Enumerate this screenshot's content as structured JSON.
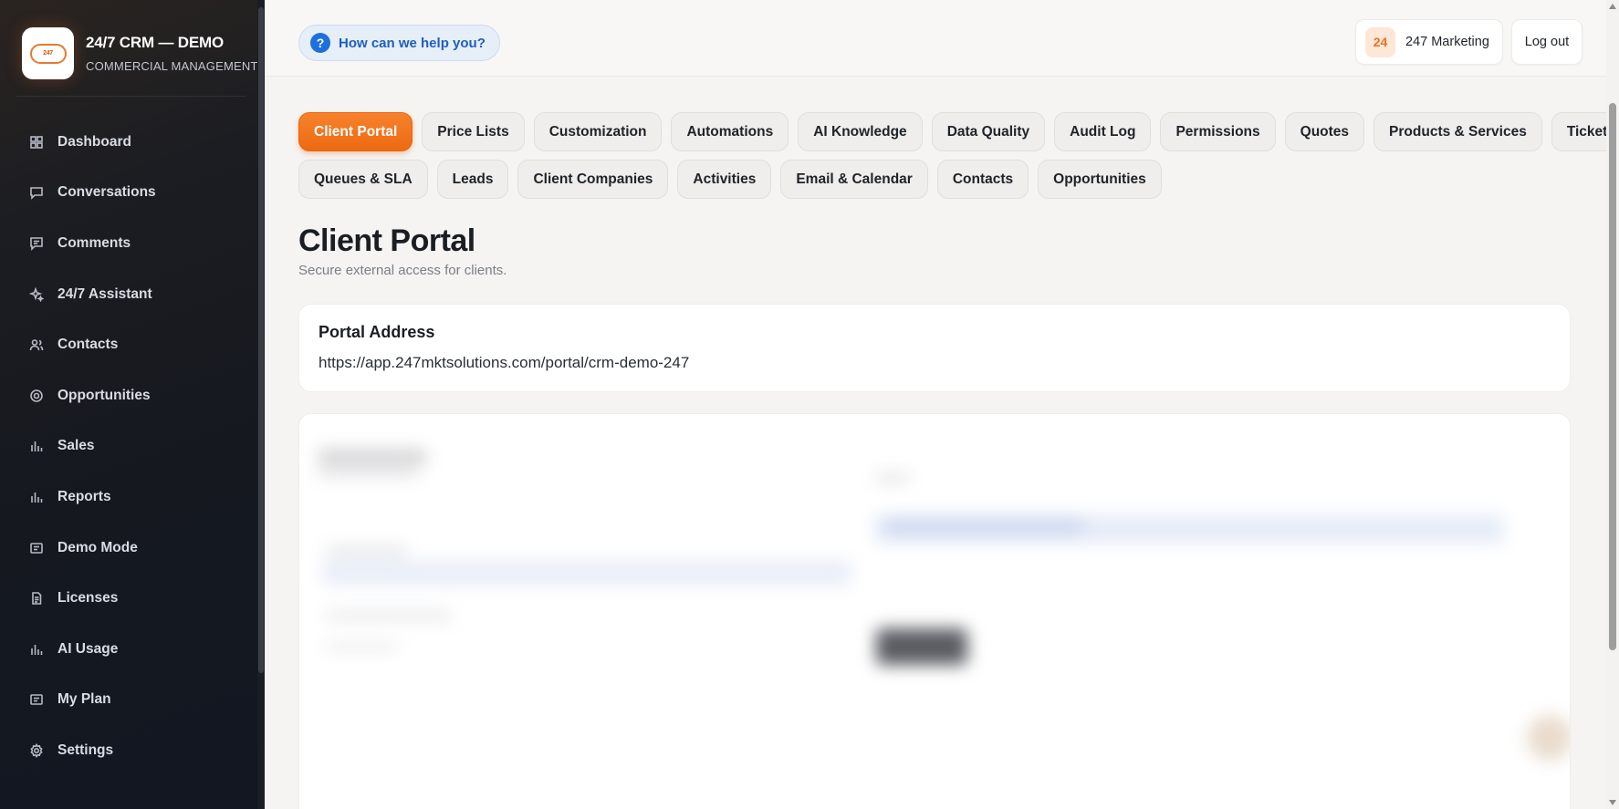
{
  "brand": {
    "title": "24/7 CRM — DEMO",
    "subtitle": "COMMERCIAL MANAGEMENT",
    "logo_text": "247"
  },
  "sidebar": {
    "items": [
      {
        "label": "Dashboard",
        "icon": "grid-icon"
      },
      {
        "label": "Conversations",
        "icon": "chat-bubble-icon"
      },
      {
        "label": "Comments",
        "icon": "comment-icon"
      },
      {
        "label": "24/7 Assistant",
        "icon": "sparkle-icon"
      },
      {
        "label": "Contacts",
        "icon": "users-icon"
      },
      {
        "label": "Opportunities",
        "icon": "target-icon"
      },
      {
        "label": "Sales",
        "icon": "bar-chart-icon"
      },
      {
        "label": "Reports",
        "icon": "bar-chart-icon"
      },
      {
        "label": "Demo Mode",
        "icon": "card-icon"
      },
      {
        "label": "Licenses",
        "icon": "document-icon"
      },
      {
        "label": "AI Usage",
        "icon": "bar-chart-icon"
      },
      {
        "label": "My Plan",
        "icon": "card-icon"
      },
      {
        "label": "Settings",
        "icon": "gear-icon"
      }
    ]
  },
  "topbar": {
    "help_label": "How can we help you?",
    "help_icon": "?",
    "account_badge": "24",
    "account_name": "247 Marketing",
    "logout_label": "Log out"
  },
  "tabs": {
    "row1": [
      "Client Portal",
      "Price Lists",
      "Customization",
      "Automations",
      "AI Knowledge",
      "Data Quality",
      "Audit Log",
      "Permissions",
      "Quotes",
      "Products & Services",
      "Tickets"
    ],
    "row2": [
      "Queues & SLA",
      "Leads",
      "Client Companies",
      "Activities",
      "Email & Calendar",
      "Contacts",
      "Opportunities"
    ],
    "active": "Client Portal"
  },
  "page": {
    "title": "Client Portal",
    "subtitle": "Secure external access for clients."
  },
  "portal_card": {
    "title": "Portal Address",
    "url": "https://app.247mktsolutions.com/portal/crm-demo-247"
  },
  "colors": {
    "accent": "#ec6a12",
    "sidebar_bg": "#15181f",
    "help_blue": "#1f6fdc"
  }
}
